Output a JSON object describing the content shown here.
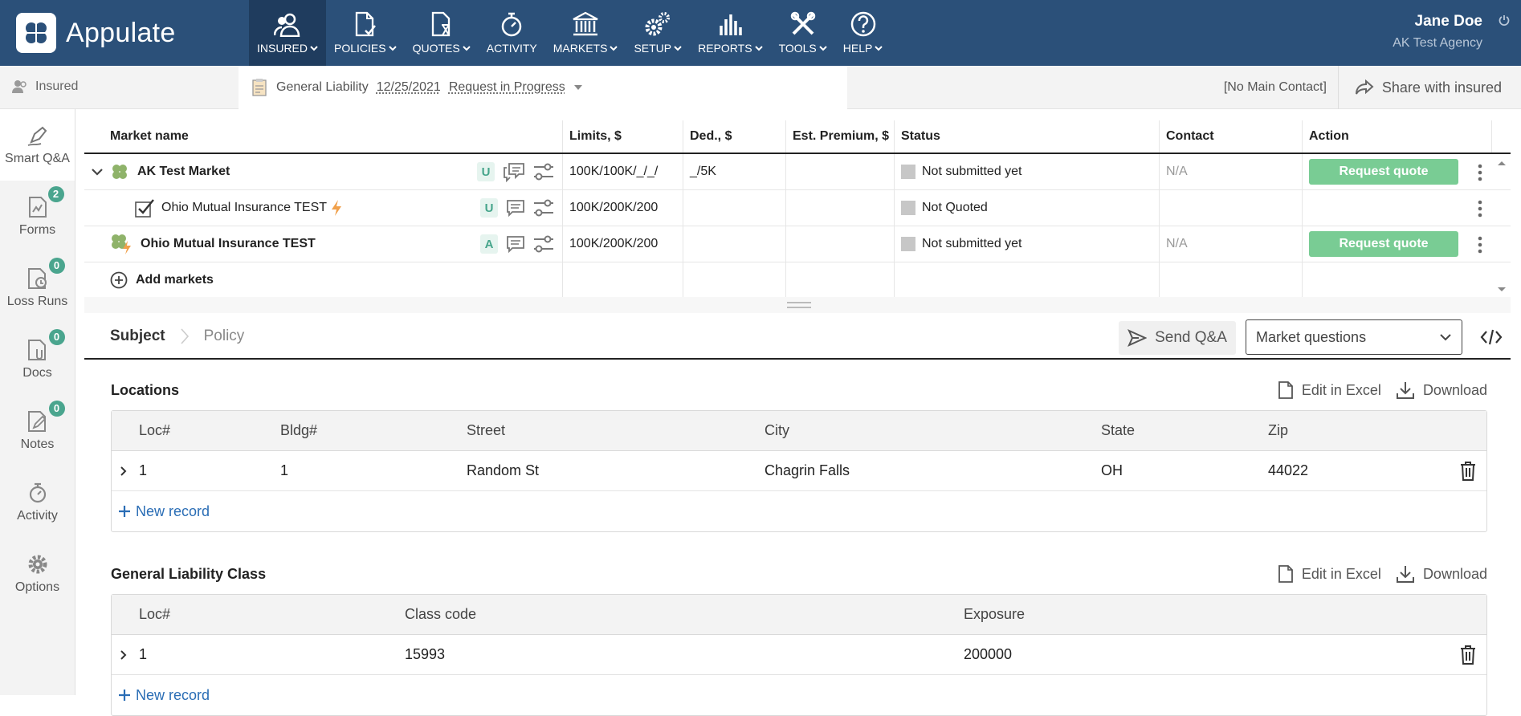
{
  "app": {
    "name": "Appulate"
  },
  "nav": [
    {
      "label": "INSURED",
      "icon": "users-icon",
      "active": true,
      "dropdown": true
    },
    {
      "label": "POLICIES",
      "icon": "policy-doc-icon",
      "dropdown": true
    },
    {
      "label": "QUOTES",
      "icon": "quote-hourglass-icon",
      "dropdown": true
    },
    {
      "label": "ACTIVITY",
      "icon": "activity-stopwatch-icon",
      "dropdown": false
    },
    {
      "label": "MARKETS",
      "icon": "bank-icon",
      "dropdown": true
    },
    {
      "label": "SETUP",
      "icon": "gears-icon",
      "dropdown": true
    },
    {
      "label": "REPORTS",
      "icon": "bar-chart-icon",
      "dropdown": true
    },
    {
      "label": "TOOLS",
      "icon": "tools-icon",
      "dropdown": true
    },
    {
      "label": "HELP",
      "icon": "help-circle-icon",
      "dropdown": true
    }
  ],
  "user": {
    "name": "Jane Doe",
    "agency": "AK Test Agency"
  },
  "subheader": {
    "insured_label": "Insured",
    "policy_type": "General Liability",
    "policy_date": "12/25/2021",
    "policy_status": "Request in Progress",
    "main_contact": "[No Main Contact]",
    "share_label": "Share with insured"
  },
  "sidebar": [
    {
      "label": "Smart Q&A",
      "icon": "pen-icon",
      "badge": "",
      "active": true
    },
    {
      "label": "Forms",
      "icon": "forms-icon",
      "badge": "2"
    },
    {
      "label": "Loss Runs",
      "icon": "loss-runs-icon",
      "badge": "0"
    },
    {
      "label": "Docs",
      "icon": "docs-icon",
      "badge": "0"
    },
    {
      "label": "Notes",
      "icon": "notes-icon",
      "badge": "0"
    },
    {
      "label": "Activity",
      "icon": "activity-icon",
      "badge": ""
    },
    {
      "label": "Options",
      "icon": "gear-icon",
      "badge": ""
    }
  ],
  "markets": {
    "columns": [
      "Market name",
      "Limits, $",
      "Ded., $",
      "Est. Premium, $",
      "Status",
      "Contact",
      "Action"
    ],
    "rows": [
      {
        "name": "AK Test Market",
        "tag": "U",
        "limits": "100K/100K/_/_/",
        "ded": "_/5K",
        "premium": "",
        "status": "Not submitted yet",
        "contact": "N/A",
        "action": "Request quote"
      },
      {
        "name": "Ohio Mutual Insurance TEST",
        "tag": "U",
        "limits": "100K/200K/200",
        "ded": "",
        "premium": "",
        "status": "Not Quoted",
        "contact": "",
        "action": ""
      },
      {
        "name": "Ohio Mutual Insurance TEST",
        "tag": "A",
        "limits": "100K/200K/200",
        "ded": "",
        "premium": "",
        "status": "Not submitted yet",
        "contact": "N/A",
        "action": "Request quote"
      }
    ],
    "add_label": "Add markets"
  },
  "qa": {
    "breadcrumb": [
      "Subject",
      "Policy"
    ],
    "send_label": "Send Q&A",
    "select_value": "Market questions"
  },
  "locations": {
    "title": "Locations",
    "edit_label": "Edit in Excel",
    "download_label": "Download",
    "columns": [
      "Loc#",
      "Bldg#",
      "Street",
      "City",
      "State",
      "Zip"
    ],
    "rows": [
      {
        "loc": "1",
        "bldg": "1",
        "street": "Random St",
        "city": "Chagrin Falls",
        "state": "OH",
        "zip": "44022"
      }
    ],
    "new_label": "New record"
  },
  "gl_class": {
    "title": "General Liability Class",
    "edit_label": "Edit in Excel",
    "download_label": "Download",
    "columns": [
      "Loc#",
      "Class code",
      "Exposure"
    ],
    "rows": [
      {
        "loc": "1",
        "class_code": "15993",
        "exposure": "200000"
      }
    ],
    "new_label": "New record"
  },
  "colors": {
    "nav_bg": "#2b5079",
    "nav_active": "#1f3c5e",
    "accent_green": "#79cc94",
    "badge": "#4aa58e",
    "link": "#2a6db5"
  }
}
